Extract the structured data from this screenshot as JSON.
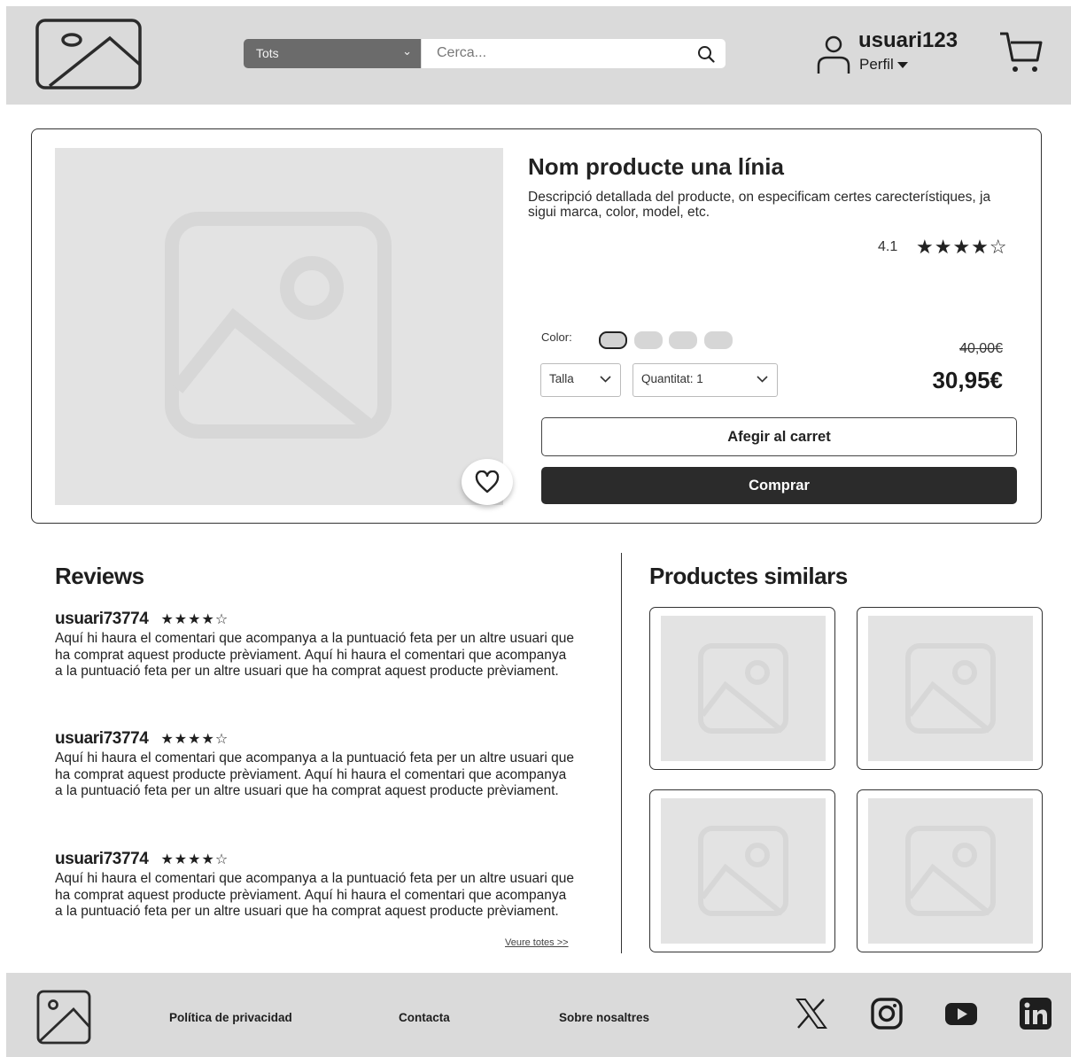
{
  "header": {
    "category_select": "Tots",
    "search_placeholder": "Cerca...",
    "username": "usuari123",
    "profile_label": "Perfil"
  },
  "product": {
    "title": "Nom producte una línia",
    "description": "Descripció detallada del producte, on especificam certes carecterístiques, ja sigui marca, color, model, etc.",
    "rating": "4.1",
    "rating_stars": "★★★★☆",
    "color_label": "Color:",
    "size_select": "Talla",
    "quantity_select": "Quantitat: 1",
    "old_price": "40,00€",
    "price": "30,95€",
    "add_to_cart_label": "Afegir al carret",
    "buy_label": "Comprar"
  },
  "reviews": {
    "title": "Reviews",
    "items": [
      {
        "user": "usuari73774",
        "stars": "★★★★☆",
        "text": "Aquí hi haura el comentari que acompanya a la puntuació feta per un altre usuari que ha comprat aquest producte prèviament. Aquí hi haura el comentari que acompanya a la puntuació feta per un altre usuari que ha comprat aquest producte prèviament."
      },
      {
        "user": "usuari73774",
        "stars": "★★★★☆",
        "text": "Aquí hi haura el comentari que acompanya a la puntuació feta per un altre usuari que ha comprat aquest producte prèviament. Aquí hi haura el comentari que acompanya a la puntuació feta per un altre usuari que ha comprat aquest producte prèviament."
      },
      {
        "user": "usuari73774",
        "stars": "★★★★☆",
        "text": "Aquí hi haura el comentari que acompanya a la puntuació feta per un altre usuari que ha comprat aquest producte prèviament. Aquí hi haura el comentari que acompanya a la puntuació feta per un altre usuari que ha comprat aquest producte prèviament."
      }
    ],
    "see_all_label": "Veure totes >>"
  },
  "similar": {
    "title": "Productes similars"
  },
  "footer": {
    "links": [
      "Política de privacidad",
      "Contacta",
      "Sobre nosaltres"
    ],
    "social_icons": [
      "x-icon",
      "instagram-icon",
      "youtube-icon",
      "linkedin-icon"
    ]
  },
  "colors": {
    "header_bg": "#dadada",
    "placeholder_bg": "#e3e3e3",
    "buy_button_bg": "#2b2b2b"
  },
  "icons": {
    "logo": "image-placeholder-icon",
    "search": "search-icon",
    "user": "user-icon",
    "cart": "cart-icon",
    "favorite": "heart-icon"
  }
}
